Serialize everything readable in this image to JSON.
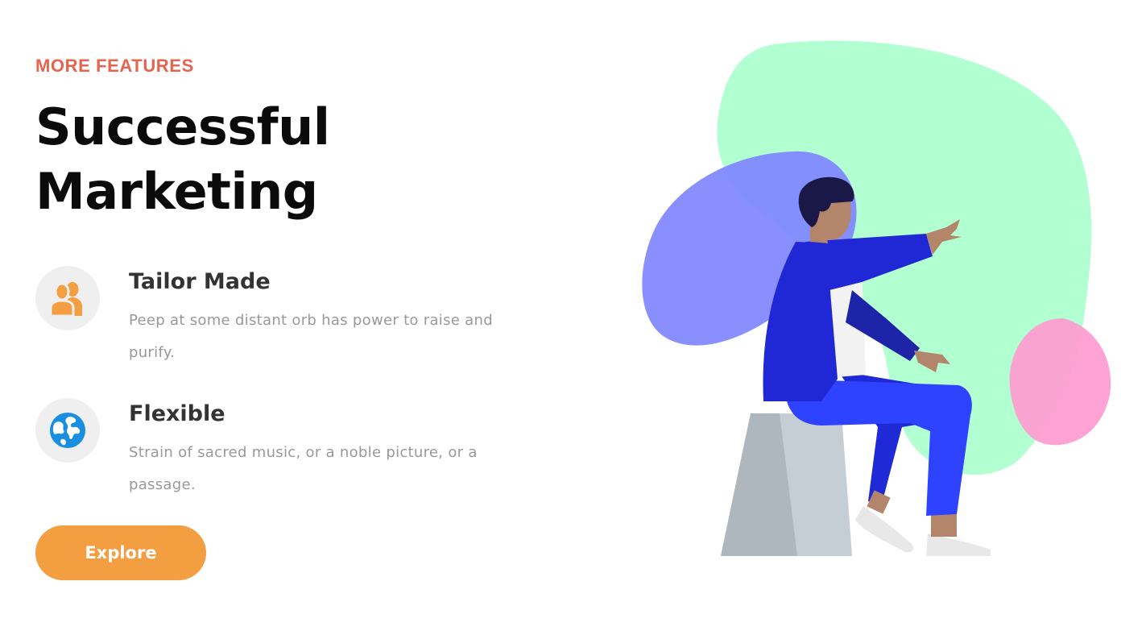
{
  "section": {
    "eyebrow": "MORE FEATURES",
    "headline_line1": "Successful",
    "headline_line2": "Marketing"
  },
  "features": [
    {
      "icon": "users-icon",
      "title": "Tailor Made",
      "description": "Peep at some distant orb has power to raise and purify."
    },
    {
      "icon": "globe-icon",
      "title": "Flexible",
      "description": "Strain of sacred music, or a noble picture, or a passage."
    }
  ],
  "cta": {
    "label": "Explore"
  },
  "colors": {
    "accent": "#e6644f",
    "button": "#f49e42",
    "users_icon": "#f49e42",
    "globe_icon": "#1a8fe0",
    "blob_green": "#b2ffd2",
    "blob_purple": "#7f86ff",
    "blob_pink": "#ff9bd0",
    "jacket": "#2028d6",
    "pants": "#2d43ff"
  }
}
